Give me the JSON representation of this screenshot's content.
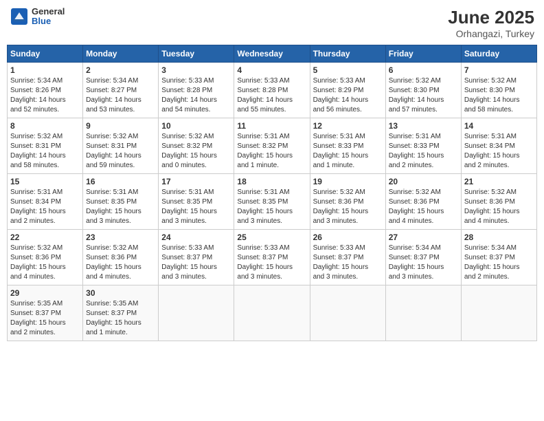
{
  "header": {
    "logo_general": "General",
    "logo_blue": "Blue",
    "month_year": "June 2025",
    "location": "Orhangazi, Turkey"
  },
  "weekdays": [
    "Sunday",
    "Monday",
    "Tuesday",
    "Wednesday",
    "Thursday",
    "Friday",
    "Saturday"
  ],
  "weeks": [
    [
      {
        "day": "1",
        "lines": [
          "Sunrise: 5:34 AM",
          "Sunset: 8:26 PM",
          "Daylight: 14 hours",
          "and 52 minutes."
        ]
      },
      {
        "day": "2",
        "lines": [
          "Sunrise: 5:34 AM",
          "Sunset: 8:27 PM",
          "Daylight: 14 hours",
          "and 53 minutes."
        ]
      },
      {
        "day": "3",
        "lines": [
          "Sunrise: 5:33 AM",
          "Sunset: 8:28 PM",
          "Daylight: 14 hours",
          "and 54 minutes."
        ]
      },
      {
        "day": "4",
        "lines": [
          "Sunrise: 5:33 AM",
          "Sunset: 8:28 PM",
          "Daylight: 14 hours",
          "and 55 minutes."
        ]
      },
      {
        "day": "5",
        "lines": [
          "Sunrise: 5:33 AM",
          "Sunset: 8:29 PM",
          "Daylight: 14 hours",
          "and 56 minutes."
        ]
      },
      {
        "day": "6",
        "lines": [
          "Sunrise: 5:32 AM",
          "Sunset: 8:30 PM",
          "Daylight: 14 hours",
          "and 57 minutes."
        ]
      },
      {
        "day": "7",
        "lines": [
          "Sunrise: 5:32 AM",
          "Sunset: 8:30 PM",
          "Daylight: 14 hours",
          "and 58 minutes."
        ]
      }
    ],
    [
      {
        "day": "8",
        "lines": [
          "Sunrise: 5:32 AM",
          "Sunset: 8:31 PM",
          "Daylight: 14 hours",
          "and 58 minutes."
        ]
      },
      {
        "day": "9",
        "lines": [
          "Sunrise: 5:32 AM",
          "Sunset: 8:31 PM",
          "Daylight: 14 hours",
          "and 59 minutes."
        ]
      },
      {
        "day": "10",
        "lines": [
          "Sunrise: 5:32 AM",
          "Sunset: 8:32 PM",
          "Daylight: 15 hours",
          "and 0 minutes."
        ]
      },
      {
        "day": "11",
        "lines": [
          "Sunrise: 5:31 AM",
          "Sunset: 8:32 PM",
          "Daylight: 15 hours",
          "and 1 minute."
        ]
      },
      {
        "day": "12",
        "lines": [
          "Sunrise: 5:31 AM",
          "Sunset: 8:33 PM",
          "Daylight: 15 hours",
          "and 1 minute."
        ]
      },
      {
        "day": "13",
        "lines": [
          "Sunrise: 5:31 AM",
          "Sunset: 8:33 PM",
          "Daylight: 15 hours",
          "and 2 minutes."
        ]
      },
      {
        "day": "14",
        "lines": [
          "Sunrise: 5:31 AM",
          "Sunset: 8:34 PM",
          "Daylight: 15 hours",
          "and 2 minutes."
        ]
      }
    ],
    [
      {
        "day": "15",
        "lines": [
          "Sunrise: 5:31 AM",
          "Sunset: 8:34 PM",
          "Daylight: 15 hours",
          "and 2 minutes."
        ]
      },
      {
        "day": "16",
        "lines": [
          "Sunrise: 5:31 AM",
          "Sunset: 8:35 PM",
          "Daylight: 15 hours",
          "and 3 minutes."
        ]
      },
      {
        "day": "17",
        "lines": [
          "Sunrise: 5:31 AM",
          "Sunset: 8:35 PM",
          "Daylight: 15 hours",
          "and 3 minutes."
        ]
      },
      {
        "day": "18",
        "lines": [
          "Sunrise: 5:31 AM",
          "Sunset: 8:35 PM",
          "Daylight: 15 hours",
          "and 3 minutes."
        ]
      },
      {
        "day": "19",
        "lines": [
          "Sunrise: 5:32 AM",
          "Sunset: 8:36 PM",
          "Daylight: 15 hours",
          "and 3 minutes."
        ]
      },
      {
        "day": "20",
        "lines": [
          "Sunrise: 5:32 AM",
          "Sunset: 8:36 PM",
          "Daylight: 15 hours",
          "and 4 minutes."
        ]
      },
      {
        "day": "21",
        "lines": [
          "Sunrise: 5:32 AM",
          "Sunset: 8:36 PM",
          "Daylight: 15 hours",
          "and 4 minutes."
        ]
      }
    ],
    [
      {
        "day": "22",
        "lines": [
          "Sunrise: 5:32 AM",
          "Sunset: 8:36 PM",
          "Daylight: 15 hours",
          "and 4 minutes."
        ]
      },
      {
        "day": "23",
        "lines": [
          "Sunrise: 5:32 AM",
          "Sunset: 8:36 PM",
          "Daylight: 15 hours",
          "and 4 minutes."
        ]
      },
      {
        "day": "24",
        "lines": [
          "Sunrise: 5:33 AM",
          "Sunset: 8:37 PM",
          "Daylight: 15 hours",
          "and 3 minutes."
        ]
      },
      {
        "day": "25",
        "lines": [
          "Sunrise: 5:33 AM",
          "Sunset: 8:37 PM",
          "Daylight: 15 hours",
          "and 3 minutes."
        ]
      },
      {
        "day": "26",
        "lines": [
          "Sunrise: 5:33 AM",
          "Sunset: 8:37 PM",
          "Daylight: 15 hours",
          "and 3 minutes."
        ]
      },
      {
        "day": "27",
        "lines": [
          "Sunrise: 5:34 AM",
          "Sunset: 8:37 PM",
          "Daylight: 15 hours",
          "and 3 minutes."
        ]
      },
      {
        "day": "28",
        "lines": [
          "Sunrise: 5:34 AM",
          "Sunset: 8:37 PM",
          "Daylight: 15 hours",
          "and 2 minutes."
        ]
      }
    ],
    [
      {
        "day": "29",
        "lines": [
          "Sunrise: 5:35 AM",
          "Sunset: 8:37 PM",
          "Daylight: 15 hours",
          "and 2 minutes."
        ]
      },
      {
        "day": "30",
        "lines": [
          "Sunrise: 5:35 AM",
          "Sunset: 8:37 PM",
          "Daylight: 15 hours",
          "and 1 minute."
        ]
      },
      {
        "day": "",
        "lines": []
      },
      {
        "day": "",
        "lines": []
      },
      {
        "day": "",
        "lines": []
      },
      {
        "day": "",
        "lines": []
      },
      {
        "day": "",
        "lines": []
      }
    ]
  ]
}
